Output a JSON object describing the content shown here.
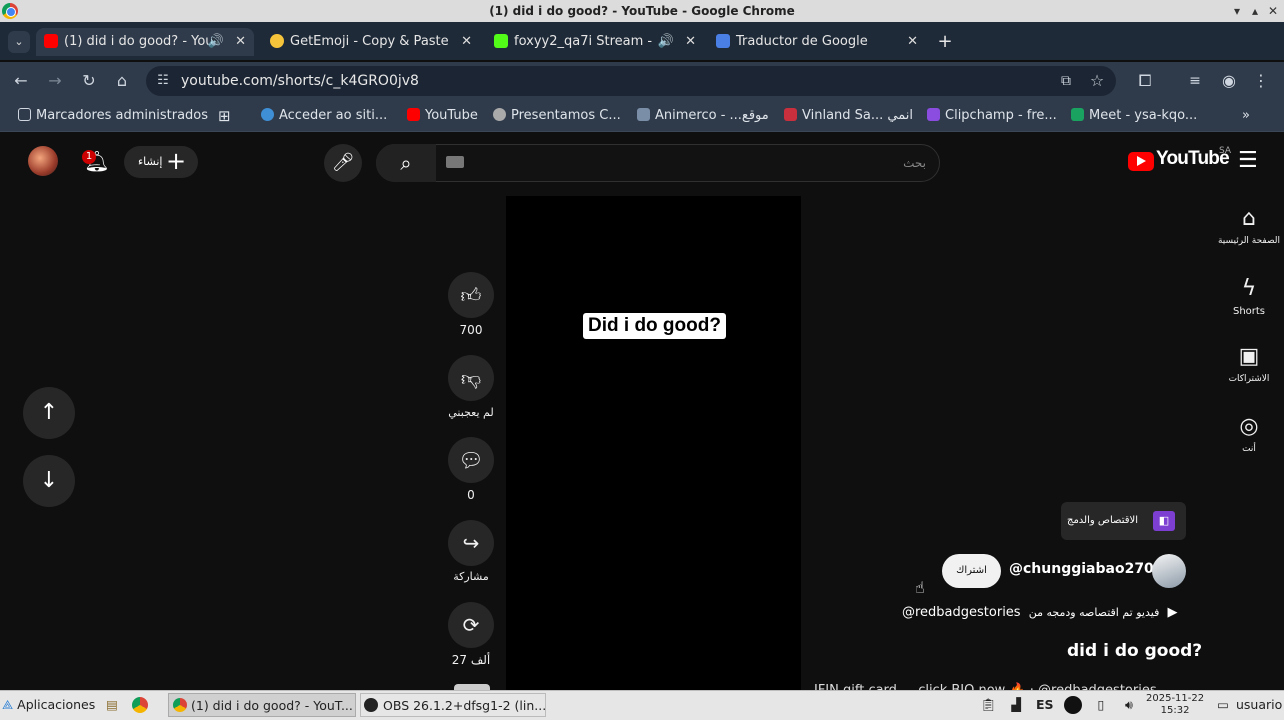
{
  "window": {
    "title": "(1) did i do good? - YouTube - Google Chrome"
  },
  "tabs": [
    {
      "label": "(1) did i do good? - You",
      "icon": "youtube-icon",
      "color": "#ff0000"
    },
    {
      "label": "GetEmoji - Copy & Paste",
      "icon": "emoji-icon",
      "color": "#f6c43a"
    },
    {
      "label": "foxyy2_qa7i Stream - ",
      "icon": "kick-icon",
      "color": "#53fc18"
    },
    {
      "label": "Traductor de Google",
      "icon": "translate-icon",
      "color": "#4a7fe6"
    }
  ],
  "address": {
    "url": "youtube.com/shorts/c_k4GRO0jv8"
  },
  "bookmarks": [
    {
      "label": "Marcadores administrados"
    },
    {
      "label": "Acceder ao siti..."
    },
    {
      "label": "YouTube"
    },
    {
      "label": "Presentamos C..."
    },
    {
      "label": "Animerco - ...موقع"
    },
    {
      "label": "Vinland Sa... انمي"
    },
    {
      "label": "Clipchamp - fre..."
    },
    {
      "label": "Meet - ysa-kqo..."
    }
  ],
  "youtube": {
    "notification_count": "1",
    "create_label": "إنشاء",
    "search_placeholder": "بحث",
    "logo_text": "YouTube",
    "region": "SA",
    "video_title_overlay": "Did i do good?",
    "actions": {
      "likes": "700",
      "dislike_label": "لم يعجبني",
      "comments": "0",
      "share_label": "مشاركة",
      "remix_count": "27 ألف"
    },
    "sidebar": [
      {
        "label": "الصفحة الرئيسية",
        "icon": "home-icon"
      },
      {
        "label": "Shorts",
        "icon": "shorts-icon"
      },
      {
        "label": "الاشتراكات",
        "icon": "subscriptions-icon"
      },
      {
        "label": "أنت",
        "icon": "account-icon"
      }
    ],
    "remix_chip": "الاقتصاص والدمج",
    "channel": "@chunggiabao2706",
    "subscribe": "اشتراك",
    "remix_source_prefix": "فيديو تم اقتصاصه ودمجه من",
    "remix_source_channel": "@redbadgestories",
    "short_title": "did i do good?",
    "description": "IFIN gift card — click BIO now 🔥 · @redbadgestories"
  },
  "taskbar": {
    "start": "Aplicaciones",
    "windows": [
      "(1) did i do good? - YouT...",
      "OBS 26.1.2+dfsg1-2 (lin..."
    ],
    "lang": "ES",
    "date": "2025-11-22",
    "time": "15:32",
    "user": "usuario"
  }
}
